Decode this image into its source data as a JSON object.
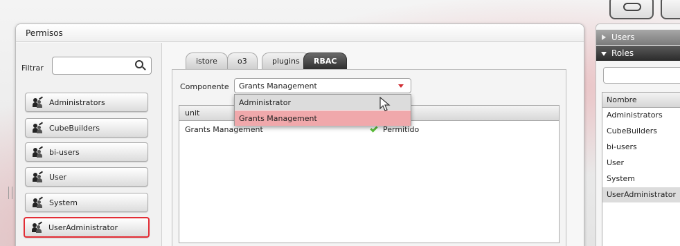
{
  "panel": {
    "title": "Permisos"
  },
  "filter": {
    "label": "Filtrar",
    "value": "",
    "placeholder": ""
  },
  "groups": [
    {
      "label": "Administrators"
    },
    {
      "label": "CubeBuilders"
    },
    {
      "label": "bi-users"
    },
    {
      "label": "User"
    },
    {
      "label": "System"
    },
    {
      "label": "UserAdministrator",
      "selected": true
    }
  ],
  "tabs": [
    {
      "label": "istore"
    },
    {
      "label": "o3"
    },
    {
      "label": "plugins"
    },
    {
      "label": "RBAC",
      "active": true
    }
  ],
  "component": {
    "label": "Componente",
    "selected": "Grants Management"
  },
  "dropdown": {
    "options": [
      "Administrator",
      "Grants Management"
    ]
  },
  "table": {
    "columns": [
      "unit",
      ""
    ],
    "rows": [
      {
        "unit": "Grants Management",
        "status": "Permitido"
      }
    ]
  },
  "right_panel": {
    "sections": [
      {
        "label": "Users"
      },
      {
        "label": "Roles"
      }
    ],
    "table_header": "Nombre",
    "roles": [
      "Administrators",
      "CubeBuilders",
      "bi-users",
      "User",
      "System",
      "UserAdministrator"
    ]
  },
  "colors": {
    "accent": "#e32d35",
    "highlight": "#f0a8ab",
    "check": "#5cbf3a"
  }
}
